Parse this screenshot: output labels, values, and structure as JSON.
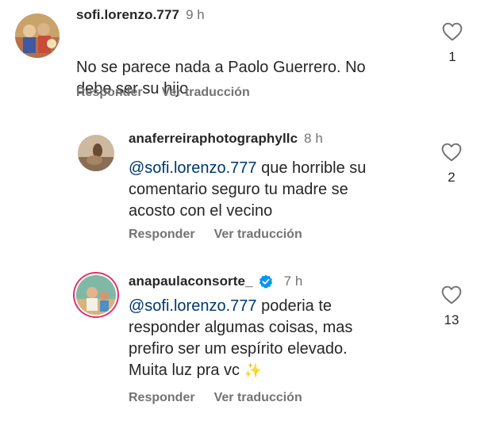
{
  "comments": [
    {
      "username": "sofi.lorenzo.777",
      "time": "9 h",
      "mention": "",
      "text": "No se parece nada a Paolo Guerrero. No\ndebe ser su hijo",
      "emoji": "",
      "reply_label": "Responder",
      "translate_label": "Ver traducción",
      "likes": "1",
      "verified": false
    },
    {
      "username": "anaferreiraphotographyllc",
      "time": "8 h",
      "mention": "@sofi.lorenzo.777",
      "text": "  que horrible su\ncomentario  seguro tu madre  se\nacosto  con el vecino",
      "emoji": "",
      "reply_label": "Responder",
      "translate_label": "Ver traducción",
      "likes": "2",
      "verified": false
    },
    {
      "username": "anapaulaconsorte_",
      "time": "7 h",
      "mention": "@sofi.lorenzo.777",
      "text": " poderia te\nresponder algumas coisas, mas\nprefiro  ser um espírito elevado.\nMuita luz pra vc ",
      "emoji": "✨",
      "reply_label": "Responder",
      "translate_label": "Ver traducción",
      "likes": "13",
      "verified": true
    }
  ],
  "icons": {
    "like": "heart-outline-icon",
    "verified": "verified-badge-icon",
    "colors": {
      "verified_blue": "#0095f6",
      "mention": "#00376b",
      "muted": "#737373"
    }
  }
}
